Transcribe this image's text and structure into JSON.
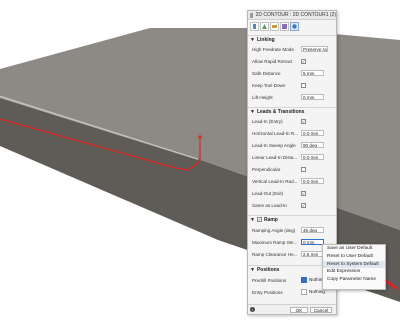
{
  "dialog": {
    "title": "2D CONTOUR : 2D CONTOUR1 (2)",
    "tabs": [
      "tool-tab",
      "geometry-tab",
      "heights-tab",
      "passes-tab",
      "linking-tab"
    ]
  },
  "linking": {
    "title": "Linking",
    "high_feedrate_mode": {
      "label": "High Feedrate Mode",
      "value": "Preserve rap..."
    },
    "allow_rapid_retract": {
      "label": "Allow Rapid Retract",
      "checked": true
    },
    "safe_distance": {
      "label": "Safe Distance",
      "value": "5 mm"
    },
    "keep_tool_down": {
      "label": "Keep Tool Down",
      "checked": false
    },
    "lift_height": {
      "label": "Lift Height",
      "value": "0 mm"
    }
  },
  "leads": {
    "title": "Leads & Transitions",
    "lead_in": {
      "label": "Lead-In (Entry)",
      "checked": true
    },
    "horizontal_lead_in": {
      "label": "Horizontal Lead-In R...",
      "value": "0.0 mm"
    },
    "lead_in_sweep": {
      "label": "Lead-In Sweep Angle",
      "value": "90 deg"
    },
    "linear_lead_in": {
      "label": "Linear Lead-In Dista...",
      "value": "0.0 mm"
    },
    "perpendicular": {
      "label": "Perpendicular",
      "checked": false
    },
    "vertical_lead_in": {
      "label": "Vertical Lead-In Rad...",
      "value": "0.0 mm"
    },
    "lead_out": {
      "label": "Lead-Out (Exit)",
      "checked": true
    },
    "same_as_lead_in": {
      "label": "Same as Lead-In",
      "checked": true
    }
  },
  "ramp": {
    "title": "Ramp",
    "checked": true,
    "ramping_angle": {
      "label": "Ramping Angle (deg)",
      "value": "45 deg"
    },
    "max_ramp_step": {
      "label": "Maximum Ramp Ste...",
      "value": "0 mm"
    },
    "ramp_clearance": {
      "label": "Ramp Clearance He...",
      "value": "2.5 mm"
    }
  },
  "positions": {
    "title": "Positions",
    "predrill": {
      "label": "Predrill Positions",
      "value": "Nothing"
    },
    "entry": {
      "label": "Entry Positions",
      "value": "Nothing"
    }
  },
  "footer": {
    "ok": "OK",
    "cancel": "Cancel",
    "info_glyph": "i"
  },
  "context_menu": {
    "items": [
      "Save as User Default",
      "Reset to User Default",
      "Reset to System Default",
      "Edit Expression",
      "Copy Parameter Name"
    ]
  },
  "colors": {
    "panel_bg": "#f4f4f4",
    "part_top": "#8f8b86",
    "part_side": "#615e5a",
    "toolpath": "#e0251f",
    "arrow": "#d3252a",
    "selection_blue": "#2f6fc5"
  }
}
